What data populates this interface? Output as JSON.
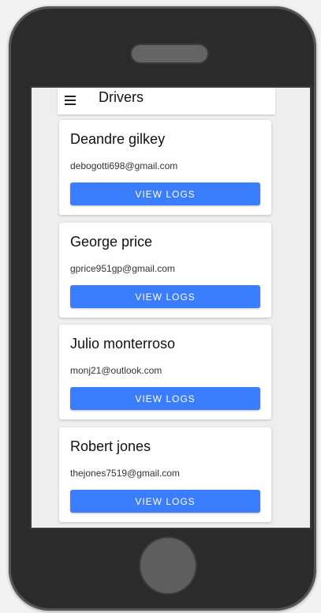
{
  "app_bar": {
    "title": "Drivers",
    "menu_icon": "hamburger-menu-icon"
  },
  "drivers": [
    {
      "name": "Deandre gilkey",
      "email": "debogotti698@gmail.com",
      "button_label": "VIEW LOGS"
    },
    {
      "name": "George price",
      "email": "gprice951gp@gmail.com",
      "button_label": "VIEW LOGS"
    },
    {
      "name": "Julio monterroso",
      "email": "monj21@outlook.com",
      "button_label": "VIEW LOGS"
    },
    {
      "name": "Robert jones",
      "email": "thejones7519@gmail.com",
      "button_label": "VIEW LOGS"
    }
  ],
  "colors": {
    "accent": "#3b7dff",
    "background": "#eeeeee",
    "device": "#2b2b2b"
  }
}
